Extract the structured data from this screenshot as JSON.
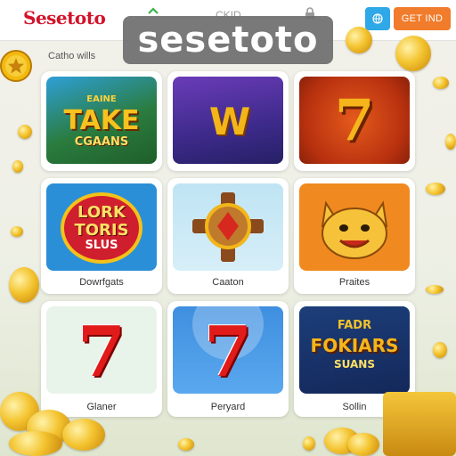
{
  "header": {
    "logo": "Sesetoto",
    "nav_text": "CKID",
    "lang_icon": "globe-icon",
    "get_button": "GET IND"
  },
  "brand_overlay": "sesetoto",
  "section": {
    "label": "Catho wills"
  },
  "games": [
    {
      "name": "Dowrfgats",
      "art_lines": [
        "EAINE",
        "TAKE",
        "CGAANS"
      ]
    },
    {
      "name": "",
      "art_lines": [
        "W"
      ]
    },
    {
      "name": "",
      "art_lines": [
        "7"
      ]
    },
    {
      "name": "Dowrfgats",
      "art_lines": [
        "LORK",
        "TORIS",
        "SLUS"
      ]
    },
    {
      "name": "Caaton",
      "art_lines": []
    },
    {
      "name": "Praites",
      "art_lines": []
    },
    {
      "name": "Glaner",
      "art_lines": [
        "7"
      ]
    },
    {
      "name": "Peryard",
      "art_lines": [
        "7"
      ]
    },
    {
      "name": "Sollin",
      "art_lines": [
        "FADR",
        "FOKIARS",
        "SUANS"
      ]
    }
  ],
  "colors": {
    "brand_red": "#d3122a",
    "lang_blue": "#2ea8e6",
    "cta_orange": "#f07c2c"
  }
}
